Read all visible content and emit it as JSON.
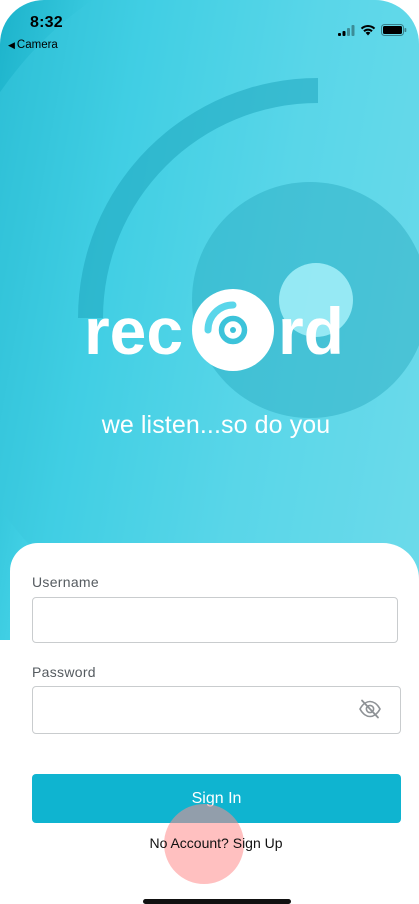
{
  "status_bar": {
    "time": "8:32",
    "back_app_label": "Camera",
    "back_arrow_glyph": "◀"
  },
  "brand": {
    "logo_text_left": "rec",
    "logo_text_right": "rd",
    "tagline": "we listen...so do you",
    "primary_color": "#0fb4d0"
  },
  "login": {
    "username_label": "Username",
    "username_value": "",
    "password_label": "Password",
    "password_value": "",
    "password_visibility_icon": "eye-off-icon",
    "sign_in_label": "Sign In",
    "sign_up_text": "No Account? Sign Up"
  }
}
